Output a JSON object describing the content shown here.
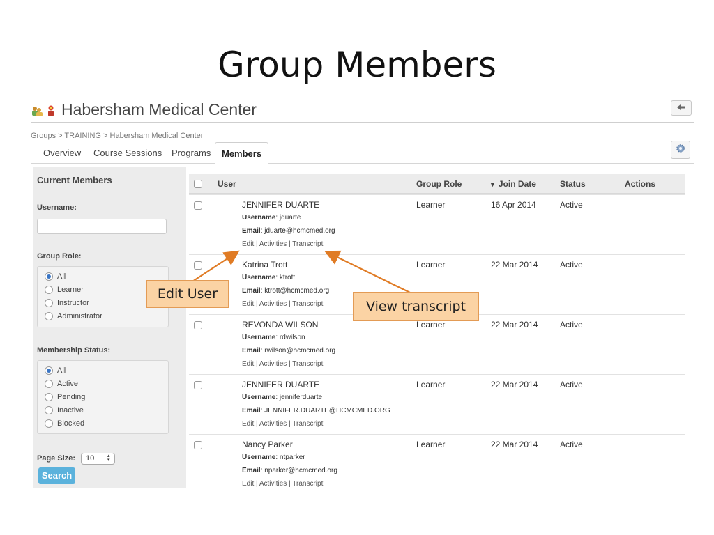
{
  "slide": {
    "title": "Group Members"
  },
  "org": {
    "name": "Habersham Medical Center"
  },
  "breadcrumb": "Groups > TRAINING > Habersham Medical Center",
  "tabs": [
    {
      "label": "Overview"
    },
    {
      "label": "Course Sessions"
    },
    {
      "label": "Programs"
    },
    {
      "label": "Members",
      "active": true
    }
  ],
  "sidebar": {
    "title": "Current Members",
    "username_label": "Username:",
    "username_value": "",
    "group_role_label": "Group Role:",
    "group_role_options": [
      "All",
      "Learner",
      "Instructor",
      "Administrator"
    ],
    "group_role_selected": "All",
    "membership_label": "Membership Status:",
    "membership_options": [
      "All",
      "Active",
      "Pending",
      "Inactive",
      "Blocked"
    ],
    "membership_selected": "All",
    "page_size_label": "Page Size:",
    "page_size_value": "10",
    "search_label": "Search"
  },
  "table": {
    "columns": {
      "user": "User",
      "group_role": "Group Role",
      "join_date": "Join Date",
      "status": "Status",
      "actions": "Actions"
    },
    "sort_indicator": "▼",
    "username_label": "Username",
    "email_label": "Email",
    "links": [
      "Edit",
      "Activities",
      "Transcript"
    ],
    "link_separator": " | ",
    "rows": [
      {
        "name": "JENNIFER DUARTE",
        "username": "jduarte",
        "email": "jduarte@hcmcmed.org",
        "role": "Learner",
        "join_date": "16 Apr 2014",
        "status": "Active"
      },
      {
        "name": "Katrina Trott",
        "username": "ktrott",
        "email": "ktrott@hcmcmed.org",
        "role": "Learner",
        "join_date": "22 Mar 2014",
        "status": "Active"
      },
      {
        "name": "REVONDA WILSON",
        "username": "rdwilson",
        "email": "rwilson@hcmcmed.org",
        "role": "Learner",
        "join_date": "22 Mar 2014",
        "status": "Active"
      },
      {
        "name": "JENNIFER DUARTE",
        "username": "jenniferduarte",
        "email": "JENNIFER.DUARTE@HCMCMED.ORG",
        "role": "Learner",
        "join_date": "22 Mar 2014",
        "status": "Active"
      },
      {
        "name": "Nancy Parker",
        "username": "ntparker",
        "email": "nparker@hcmcmed.org",
        "role": "Learner",
        "join_date": "22 Mar 2014",
        "status": "Active"
      }
    ]
  },
  "callouts": {
    "edit_user": "Edit User",
    "view_transcript": "View transcript"
  },
  "colors": {
    "accent": "#5bb2dc",
    "callout_fill": "#fbd3a4",
    "arrow": "#e07b24",
    "radio_checked": "#3a75c4"
  },
  "icons": {
    "back": "back-arrow-icon",
    "settings": "gear-icon",
    "org": "group-people-icon"
  }
}
